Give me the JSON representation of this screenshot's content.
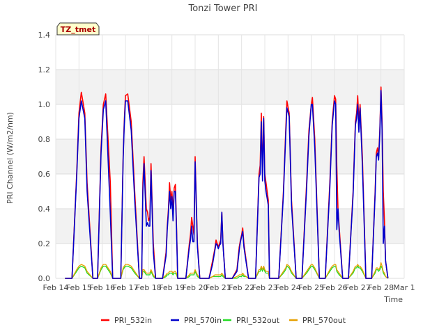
{
  "chart_data": {
    "type": "line",
    "title": "Tonzi Tower PRI",
    "ylabel": "PRI Channel (W/m2/nm)",
    "xlabel": "Time",
    "badge": "TZ_tmet",
    "ylim": [
      0,
      1.4
    ],
    "yticks": [
      0.0,
      0.2,
      0.4,
      0.6,
      0.8,
      1.0,
      1.2,
      1.4
    ],
    "ytick_labels": [
      "0.0",
      "0.2",
      "0.4",
      "0.6",
      "0.8",
      "1.0",
      "1.2",
      "1.4"
    ],
    "xlim": [
      0,
      15
    ],
    "xticks": [
      0,
      1,
      2,
      3,
      4,
      5,
      6,
      7,
      8,
      9,
      10,
      11,
      12,
      13,
      14,
      15
    ],
    "xtick_labels": [
      "Feb 14",
      "Feb 15",
      "Feb 16",
      "Feb 17",
      "Feb 18",
      "Feb 19",
      "Feb 20",
      "Feb 21",
      "Feb 22",
      "Feb 23",
      "Feb 24",
      "Feb 25",
      "Feb 26",
      "Feb 27",
      "Feb 28",
      "Mar 1"
    ],
    "grid": true,
    "legend_position": "bottom",
    "colors": {
      "PRI_532in": "#ff0000",
      "PRI_570in": "#0000cc",
      "PRI_532out": "#22dd22",
      "PRI_570out": "#e6a000"
    },
    "series": [
      {
        "name": "PRI_532in",
        "x": [
          0.4,
          0.7,
          0.9,
          1.0,
          1.1,
          1.25,
          1.35,
          1.6,
          1.8,
          1.95,
          2.05,
          2.15,
          2.35,
          2.45,
          2.6,
          2.8,
          2.9,
          2.95,
          3.0,
          3.1,
          3.25,
          3.4,
          3.6,
          3.7,
          3.75,
          3.8,
          3.9,
          3.95,
          4.0,
          4.05,
          4.1,
          4.2,
          4.3,
          4.6,
          4.75,
          4.8,
          4.85,
          4.9,
          4.95,
          5.0,
          5.05,
          5.1,
          5.15,
          5.2,
          5.25,
          5.35,
          5.6,
          5.75,
          5.8,
          5.85,
          5.9,
          5.95,
          6.0,
          6.1,
          6.2,
          6.4,
          6.6,
          6.75,
          6.85,
          6.9,
          6.95,
          7.0,
          7.05,
          7.1,
          7.15,
          7.2,
          7.3,
          7.6,
          7.8,
          7.9,
          7.95,
          8.0,
          8.05,
          8.1,
          8.2,
          8.3,
          8.6,
          8.75,
          8.8,
          8.85,
          8.9,
          8.95,
          9.0,
          9.05,
          9.15,
          9.2,
          9.3,
          9.6,
          9.8,
          9.9,
          9.95,
          10.05,
          10.15,
          10.35,
          10.6,
          10.8,
          10.9,
          11.0,
          11.05,
          11.15,
          11.35,
          11.6,
          11.8,
          11.9,
          12.0,
          12.05,
          12.1,
          12.15,
          12.2,
          12.35,
          12.6,
          12.8,
          12.9,
          12.95,
          13.0,
          13.05,
          13.1,
          13.2,
          13.35,
          13.6,
          13.75,
          13.8,
          13.85,
          13.9,
          13.95,
          14.0,
          14.05,
          14.1,
          14.15,
          14.2,
          14.3
        ],
        "y": [
          0,
          0,
          0.6,
          0.95,
          1.07,
          0.95,
          0.55,
          0,
          0,
          0.75,
          1.0,
          1.06,
          0.55,
          0,
          0,
          0,
          0.7,
          0.9,
          1.05,
          1.06,
          0.9,
          0.5,
          0,
          0,
          0.55,
          0.7,
          0.4,
          0.38,
          0.33,
          0.35,
          0.66,
          0.2,
          0,
          0,
          0.15,
          0.3,
          0.4,
          0.55,
          0.45,
          0.5,
          0.38,
          0.52,
          0.54,
          0.3,
          0,
          0,
          0,
          0.2,
          0.25,
          0.35,
          0.3,
          0.25,
          0.7,
          0.2,
          0,
          0,
          0,
          0.1,
          0.17,
          0.22,
          0.2,
          0.18,
          0.2,
          0.22,
          0.38,
          0.2,
          0,
          0,
          0.05,
          0.18,
          0.22,
          0.25,
          0.29,
          0.2,
          0.1,
          0,
          0,
          0.6,
          0.65,
          0.95,
          0.6,
          0.93,
          0.6,
          0.55,
          0.45,
          0,
          0,
          0,
          0.5,
          0.85,
          1.02,
          0.95,
          0.45,
          0,
          0,
          0.55,
          0.85,
          1.0,
          1.04,
          0.8,
          0,
          0,
          0.55,
          0.9,
          1.05,
          1.03,
          0.65,
          0.4,
          0.3,
          0,
          0,
          0.5,
          0.9,
          0.95,
          1.05,
          0.9,
          1.0,
          0.7,
          0,
          0,
          0.5,
          0.72,
          0.75,
          0.7,
          0.85,
          1.1,
          0.9,
          0.5,
          0.33,
          0.1,
          0
        ]
      },
      {
        "name": "PRI_570in",
        "x": [
          0.4,
          0.7,
          0.9,
          1.0,
          1.1,
          1.25,
          1.35,
          1.6,
          1.8,
          1.95,
          2.05,
          2.15,
          2.35,
          2.45,
          2.6,
          2.8,
          2.9,
          2.95,
          3.0,
          3.1,
          3.25,
          3.4,
          3.6,
          3.7,
          3.75,
          3.8,
          3.9,
          3.95,
          4.0,
          4.05,
          4.1,
          4.2,
          4.3,
          4.6,
          4.75,
          4.8,
          4.85,
          4.9,
          4.95,
          5.0,
          5.05,
          5.1,
          5.15,
          5.2,
          5.25,
          5.35,
          5.6,
          5.75,
          5.8,
          5.85,
          5.9,
          5.95,
          6.0,
          6.1,
          6.2,
          6.4,
          6.6,
          6.75,
          6.85,
          6.9,
          6.95,
          7.0,
          7.05,
          7.1,
          7.15,
          7.2,
          7.3,
          7.6,
          7.8,
          7.9,
          7.95,
          8.0,
          8.05,
          8.1,
          8.2,
          8.3,
          8.6,
          8.75,
          8.8,
          8.85,
          8.9,
          8.95,
          9.0,
          9.05,
          9.15,
          9.2,
          9.3,
          9.6,
          9.8,
          9.9,
          9.95,
          10.05,
          10.15,
          10.35,
          10.6,
          10.8,
          10.9,
          11.0,
          11.05,
          11.15,
          11.35,
          11.6,
          11.8,
          11.9,
          12.0,
          12.05,
          12.1,
          12.15,
          12.2,
          12.35,
          12.6,
          12.8,
          12.9,
          12.95,
          13.0,
          13.05,
          13.1,
          13.2,
          13.35,
          13.6,
          13.75,
          13.8,
          13.85,
          13.9,
          13.95,
          14.0,
          14.05,
          14.1,
          14.15,
          14.2,
          14.3
        ],
        "y": [
          0,
          0,
          0.58,
          0.92,
          1.02,
          0.92,
          0.5,
          0,
          0,
          0.72,
          0.97,
          1.02,
          0.37,
          0,
          0,
          0,
          0.68,
          0.88,
          1.02,
          1.02,
          0.85,
          0.45,
          0,
          0,
          0.5,
          0.66,
          0.3,
          0.32,
          0.3,
          0.3,
          0.62,
          0.15,
          0,
          0,
          0.13,
          0.28,
          0.38,
          0.5,
          0.4,
          0.47,
          0.33,
          0.5,
          0.5,
          0.28,
          0,
          0,
          0,
          0.18,
          0.22,
          0.3,
          0.21,
          0.21,
          0.67,
          0.18,
          0,
          0,
          0,
          0.08,
          0.16,
          0.2,
          0.19,
          0.17,
          0.19,
          0.2,
          0.38,
          0.19,
          0,
          0,
          0.04,
          0.16,
          0.21,
          0.24,
          0.27,
          0.18,
          0.09,
          0,
          0,
          0.58,
          0.6,
          0.9,
          0.56,
          0.92,
          0.56,
          0.5,
          0.42,
          0,
          0,
          0,
          0.48,
          0.82,
          0.98,
          0.93,
          0.42,
          0,
          0,
          0.52,
          0.82,
          1.0,
          1.0,
          0.75,
          0,
          0,
          0.52,
          0.88,
          1.02,
          1.0,
          0.28,
          0.4,
          0.27,
          0,
          0,
          0.48,
          0.88,
          0.92,
          1.0,
          0.84,
          0.98,
          0.65,
          0,
          0,
          0.48,
          0.7,
          0.72,
          0.68,
          0.83,
          1.08,
          0.85,
          0.2,
          0.3,
          0.1,
          0
        ]
      },
      {
        "name": "PRI_532out",
        "x": [
          0.4,
          0.7,
          0.9,
          1.0,
          1.1,
          1.25,
          1.35,
          1.6,
          1.8,
          1.95,
          2.05,
          2.15,
          2.35,
          2.45,
          2.6,
          2.8,
          2.9,
          2.95,
          3.0,
          3.1,
          3.25,
          3.4,
          3.6,
          3.7,
          3.75,
          3.8,
          3.9,
          3.95,
          4.0,
          4.05,
          4.1,
          4.2,
          4.3,
          4.6,
          4.75,
          4.8,
          4.85,
          4.9,
          4.95,
          5.0,
          5.05,
          5.1,
          5.15,
          5.2,
          5.25,
          5.35,
          5.6,
          5.75,
          5.8,
          5.85,
          5.9,
          5.95,
          6.0,
          6.1,
          6.2,
          6.4,
          6.6,
          6.75,
          6.85,
          6.9,
          6.95,
          7.0,
          7.05,
          7.1,
          7.15,
          7.2,
          7.3,
          7.6,
          7.8,
          7.9,
          7.95,
          8.0,
          8.05,
          8.1,
          8.2,
          8.3,
          8.6,
          8.75,
          8.8,
          8.85,
          8.9,
          8.95,
          9.0,
          9.05,
          9.15,
          9.2,
          9.3,
          9.6,
          9.8,
          9.9,
          9.95,
          10.05,
          10.15,
          10.35,
          10.6,
          10.8,
          10.9,
          11.0,
          11.05,
          11.15,
          11.35,
          11.6,
          11.8,
          11.9,
          12.0,
          12.05,
          12.1,
          12.15,
          12.2,
          12.35,
          12.6,
          12.8,
          12.9,
          12.95,
          13.0,
          13.05,
          13.1,
          13.2,
          13.35,
          13.6,
          13.75,
          13.8,
          13.85,
          13.9,
          13.95,
          14.0,
          14.05,
          14.1,
          14.15,
          14.2,
          14.3
        ],
        "y": [
          0,
          0,
          0.04,
          0.06,
          0.07,
          0.06,
          0.03,
          0,
          0,
          0.05,
          0.07,
          0.07,
          0.03,
          0,
          0,
          0,
          0.05,
          0.06,
          0.07,
          0.07,
          0.06,
          0.03,
          0,
          0,
          0.04,
          0.04,
          0.02,
          0.02,
          0.02,
          0.02,
          0.04,
          0.01,
          0,
          0,
          0.01,
          0.02,
          0.02,
          0.03,
          0.03,
          0.03,
          0.02,
          0.03,
          0.03,
          0.02,
          0,
          0,
          0,
          0.01,
          0.02,
          0.02,
          0.02,
          0.02,
          0.04,
          0.01,
          0,
          0,
          0,
          0.01,
          0.01,
          0.01,
          0.01,
          0.01,
          0.01,
          0.01,
          0.02,
          0.01,
          0,
          0,
          0,
          0.01,
          0.01,
          0.01,
          0.02,
          0.01,
          0.01,
          0,
          0,
          0.04,
          0.04,
          0.06,
          0.04,
          0.06,
          0.04,
          0.03,
          0.03,
          0,
          0,
          0,
          0.03,
          0.05,
          0.07,
          0.06,
          0.03,
          0,
          0,
          0.03,
          0.05,
          0.07,
          0.07,
          0.05,
          0,
          0,
          0.04,
          0.06,
          0.07,
          0.07,
          0.04,
          0.03,
          0.02,
          0,
          0,
          0.03,
          0.06,
          0.06,
          0.07,
          0.06,
          0.06,
          0.04,
          0,
          0,
          0.03,
          0.05,
          0.05,
          0.04,
          0.05,
          0.07,
          0.06,
          0.03,
          0.02,
          0.01,
          0
        ]
      },
      {
        "name": "PRI_570out",
        "x": [
          0.4,
          0.7,
          0.9,
          1.0,
          1.1,
          1.25,
          1.35,
          1.6,
          1.8,
          1.95,
          2.05,
          2.15,
          2.35,
          2.45,
          2.6,
          2.8,
          2.9,
          2.95,
          3.0,
          3.1,
          3.25,
          3.4,
          3.6,
          3.7,
          3.75,
          3.8,
          3.9,
          3.95,
          4.0,
          4.05,
          4.1,
          4.2,
          4.3,
          4.6,
          4.75,
          4.8,
          4.85,
          4.9,
          4.95,
          5.0,
          5.05,
          5.1,
          5.15,
          5.2,
          5.25,
          5.35,
          5.6,
          5.75,
          5.8,
          5.85,
          5.9,
          5.95,
          6.0,
          6.1,
          6.2,
          6.4,
          6.6,
          6.75,
          6.85,
          6.9,
          6.95,
          7.0,
          7.05,
          7.1,
          7.15,
          7.2,
          7.3,
          7.6,
          7.8,
          7.9,
          7.95,
          8.0,
          8.05,
          8.1,
          8.2,
          8.3,
          8.6,
          8.75,
          8.8,
          8.85,
          8.9,
          8.95,
          9.0,
          9.05,
          9.15,
          9.2,
          9.3,
          9.6,
          9.8,
          9.9,
          9.95,
          10.05,
          10.15,
          10.35,
          10.6,
          10.8,
          10.9,
          11.0,
          11.05,
          11.15,
          11.35,
          11.6,
          11.8,
          11.9,
          12.0,
          12.05,
          12.1,
          12.15,
          12.2,
          12.35,
          12.6,
          12.8,
          12.9,
          12.95,
          13.0,
          13.05,
          13.1,
          13.2,
          13.35,
          13.6,
          13.75,
          13.8,
          13.85,
          13.9,
          13.95,
          14.0,
          14.05,
          14.1,
          14.15,
          14.2,
          14.3
        ],
        "y": [
          0,
          0,
          0.05,
          0.07,
          0.08,
          0.07,
          0.04,
          0,
          0,
          0.06,
          0.08,
          0.08,
          0.04,
          0,
          0,
          0,
          0.06,
          0.07,
          0.08,
          0.08,
          0.07,
          0.04,
          0,
          0,
          0.05,
          0.05,
          0.03,
          0.03,
          0.03,
          0.03,
          0.05,
          0.02,
          0,
          0,
          0.02,
          0.03,
          0.03,
          0.04,
          0.04,
          0.04,
          0.03,
          0.04,
          0.04,
          0.03,
          0,
          0,
          0,
          0.02,
          0.03,
          0.03,
          0.03,
          0.03,
          0.05,
          0.02,
          0,
          0,
          0,
          0.01,
          0.02,
          0.02,
          0.02,
          0.02,
          0.02,
          0.02,
          0.03,
          0.02,
          0,
          0,
          0.01,
          0.02,
          0.02,
          0.02,
          0.03,
          0.02,
          0.01,
          0,
          0,
          0.05,
          0.05,
          0.07,
          0.05,
          0.07,
          0.05,
          0.04,
          0.04,
          0,
          0,
          0,
          0.04,
          0.06,
          0.08,
          0.07,
          0.04,
          0,
          0,
          0.04,
          0.06,
          0.08,
          0.08,
          0.06,
          0,
          0,
          0.05,
          0.07,
          0.08,
          0.08,
          0.05,
          0.04,
          0.03,
          0,
          0,
          0.04,
          0.07,
          0.07,
          0.08,
          0.07,
          0.07,
          0.05,
          0,
          0,
          0.04,
          0.06,
          0.06,
          0.05,
          0.06,
          0.09,
          0.07,
          0.04,
          0.03,
          0.01,
          0
        ]
      }
    ]
  }
}
